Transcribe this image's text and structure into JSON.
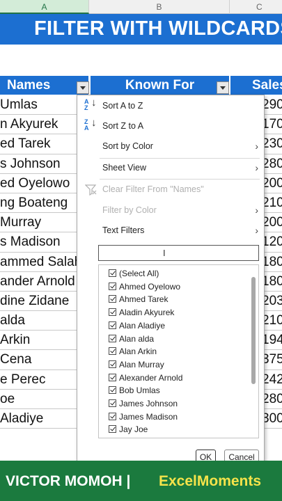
{
  "columns": [
    "A",
    "B",
    "C"
  ],
  "banner": {
    "title": "FILTER WITH WILDCARDS"
  },
  "table": {
    "headers": {
      "names": "Names",
      "known_for": "Known For",
      "sales": "Sales"
    },
    "rows": [
      {
        "name": " Umlas",
        "sales": "290"
      },
      {
        "name": "n Akyurek",
        "sales": "170"
      },
      {
        "name": "ed Tarek",
        "sales": "230"
      },
      {
        "name": "s Johnson",
        "sales": "280"
      },
      {
        "name": "ed Oyelowo",
        "sales": "200"
      },
      {
        "name": "ng Boateng",
        "sales": "210"
      },
      {
        "name": " Murray",
        "sales": "200"
      },
      {
        "name": "s Madison",
        "sales": "120"
      },
      {
        "name": "ammed Salah",
        "sales": "180"
      },
      {
        "name": "ander Arnold",
        "sales": "180"
      },
      {
        "name": "dine Zidane",
        "sales": "203"
      },
      {
        "name": "alda",
        "sales": "210"
      },
      {
        "name": "Arkin",
        "sales": "194"
      },
      {
        "name": "Cena",
        "sales": "375"
      },
      {
        "name": "e Perec",
        "sales": "242"
      },
      {
        "name": "oe",
        "sales": "280"
      },
      {
        "name": "Aladiye",
        "sales": "300"
      }
    ]
  },
  "filter_menu": {
    "sort_az": "Sort A to Z",
    "sort_za": "Sort Z to A",
    "sort_by_color": "Sort by Color",
    "sheet_view": "Sheet View",
    "clear_filter": "Clear Filter From \"Names\"",
    "filter_by_color": "Filter by Color",
    "text_filters": "Text Filters",
    "search_value": "",
    "items": [
      "(Select All)",
      "Ahmed Oyelowo",
      "Ahmed Tarek",
      "Aladin Akyurek",
      "Alan Aladiye",
      "Alan alda",
      "Alan Arkin",
      "Alan Murray",
      "Alexander Arnold",
      "Bob Umlas",
      "James Johnson",
      "James Madison",
      "Jay Joe"
    ],
    "ok": "OK",
    "cancel": "Cancel"
  },
  "footer": {
    "author": "VICTOR MOMOH |",
    "brand": "ExcelMoments"
  },
  "colors": {
    "header_blue": "#1c6fd1",
    "footer_green": "#1b7a3e",
    "brand_yellow": "#f5e34a"
  }
}
